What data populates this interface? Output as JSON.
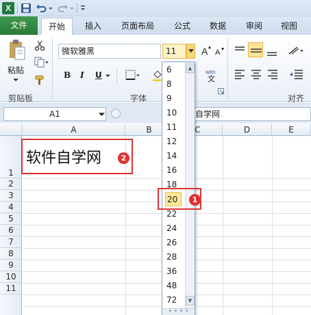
{
  "quick_access": {
    "excel_logo": "X"
  },
  "tabs": [
    "文件",
    "开始",
    "插入",
    "页面布局",
    "公式",
    "数据",
    "审阅",
    "视图"
  ],
  "ribbon": {
    "clipboard": {
      "paste_label": "粘贴",
      "group_label": "剪贴板"
    },
    "font": {
      "font_name": "微软雅黑",
      "font_size": "11",
      "bold": "B",
      "italic": "I",
      "underline": "U",
      "group_label": "字体"
    },
    "alignment": {
      "group_label": "对齐方"
    }
  },
  "formula_bar": {
    "name_box": "A1",
    "fx": "fx",
    "content": "自学网"
  },
  "columns": [
    "A",
    "B",
    "C",
    "D",
    "E"
  ],
  "rows": [
    "1",
    "2",
    "3",
    "4",
    "5",
    "6",
    "7",
    "8",
    "9",
    "10",
    "11"
  ],
  "cell_a1": "软件自学网",
  "font_size_options": [
    "6",
    "8",
    "9",
    "10",
    "11",
    "12",
    "14",
    "16",
    "18",
    "20",
    "22",
    "24",
    "26",
    "28",
    "36",
    "48",
    "72"
  ],
  "selected_font_size": "20",
  "annotations": {
    "badge_1": "1",
    "badge_2": "2"
  },
  "colors": {
    "accent_red": "#e03131",
    "file_tab_green": "#2b7a38",
    "selected_highlight": "#fce79a"
  }
}
